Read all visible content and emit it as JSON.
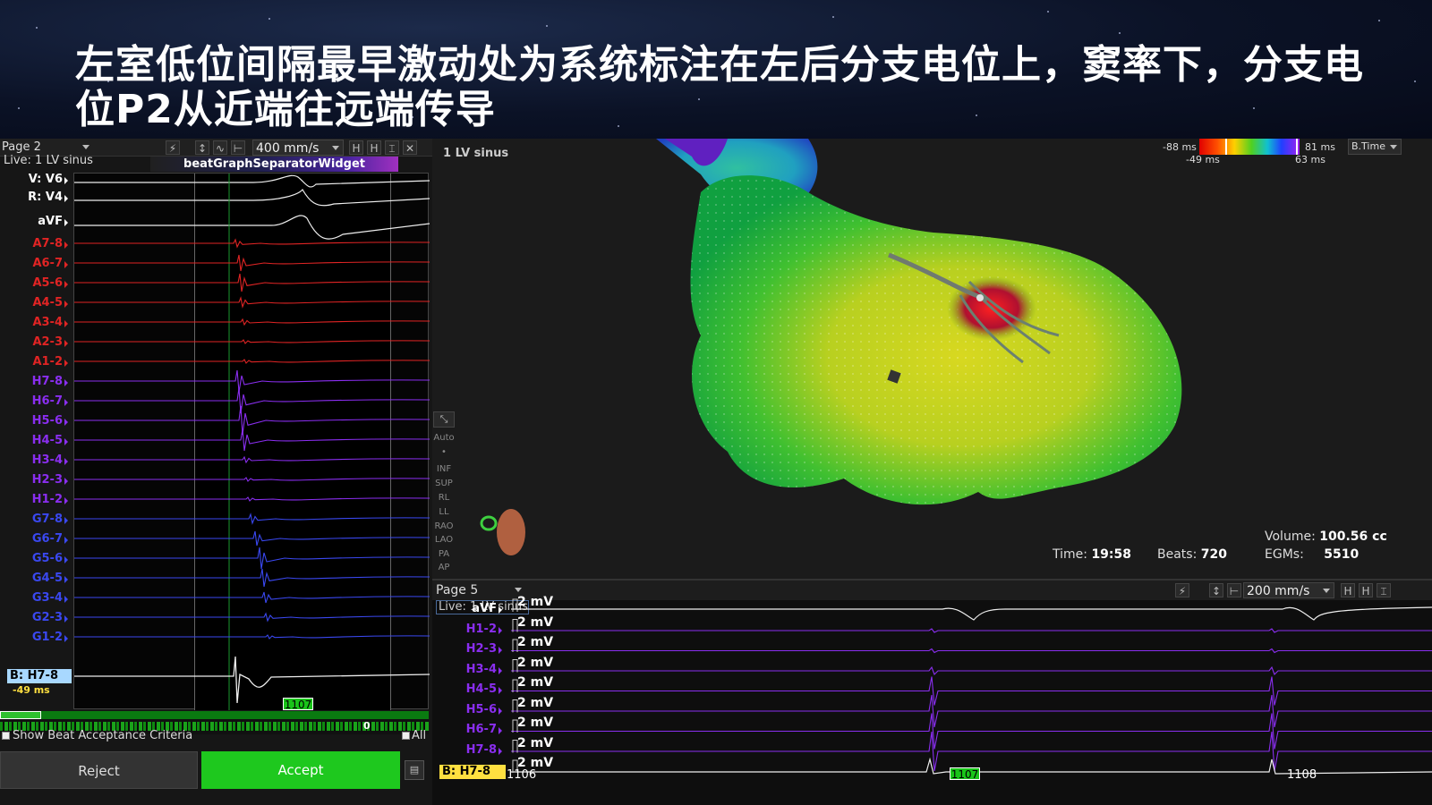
{
  "title": "左室低位间隔最早激动处为系统标注在左后分支电位上，窦率下，分支电位P2从近端往远端传导",
  "left_panel": {
    "page": "Page 2",
    "speed": "400 mm/s",
    "live": "Live: 1 LV sinus",
    "separator_widget": "beatGraphSeparatorWidget",
    "ecg_labels": [
      "V: V6",
      "R: V4",
      "aVF"
    ],
    "red_labels": [
      "A7-8",
      "A6-7",
      "A5-6",
      "A4-5",
      "A3-4",
      "A2-3",
      "A1-2"
    ],
    "purple_labels": [
      "H7-8",
      "H6-7",
      "H5-6",
      "H4-5",
      "H3-4",
      "H2-3",
      "H1-2"
    ],
    "blue_labels": [
      "G7-8",
      "G6-7",
      "G5-6",
      "G4-5",
      "G3-4",
      "G2-3",
      "G1-2"
    ],
    "ref_label": "B: H7-8",
    "ref_ms": "-49 ms",
    "beat_tag": "1107",
    "zero": "0",
    "show_criteria": "Show Beat Acceptance Criteria",
    "all": "All",
    "reject": "Reject",
    "accept": "Accept",
    "colors": {
      "red": "#e02424",
      "purple": "#8a2ef0",
      "blue": "#3a48f0",
      "accept": "#1ec81e"
    }
  },
  "map": {
    "title": "1 LV sinus",
    "scale_min_top": "-88 ms",
    "scale_min_bottom": "-49 ms",
    "scale_max_top": "81 ms",
    "scale_max_bottom": "63 ms",
    "mode": "B.Time",
    "view_tools": [
      "Auto",
      "INF",
      "SUP",
      "RL",
      "LL",
      "RAO",
      "LAO",
      "PA",
      "AP"
    ],
    "time_label": "Time:",
    "time_value": "19:58",
    "beats_label": "Beats:",
    "beats_value": "720",
    "volume_label": "Volume:",
    "volume_value": "100.56 cc",
    "egms_label": "EGMs:",
    "egms_value": "5510"
  },
  "bottom_panel": {
    "page": "Page 5",
    "speed": "200 mm/s",
    "live": "Live: 1 LV sinus",
    "labels": [
      "aVF",
      "H1-2",
      "H2-3",
      "H3-4",
      "H4-5",
      "H5-6",
      "H6-7",
      "H7-8"
    ],
    "gain": "2 mV",
    "ref_label": "B: H7-8",
    "tick_left": "1106",
    "tick_right": "1108",
    "beat_tag": "1107"
  }
}
